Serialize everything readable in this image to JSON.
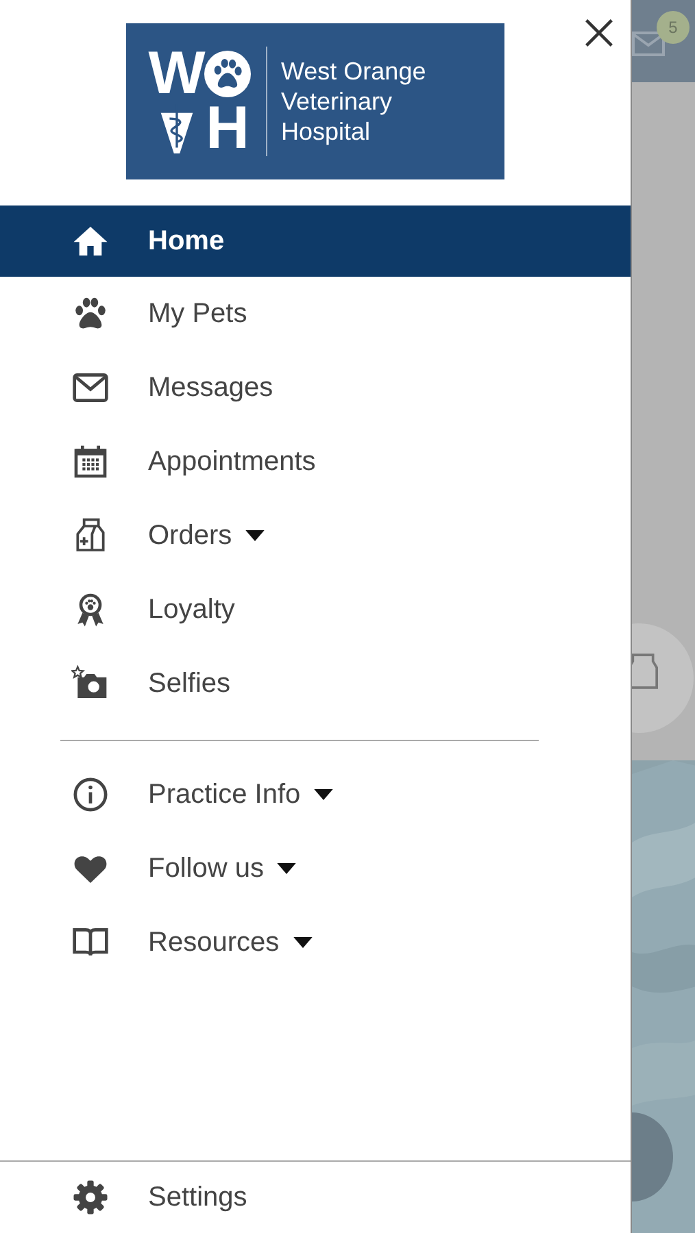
{
  "logo": {
    "letters": [
      "W",
      "H"
    ],
    "name_lines": [
      "West Orange",
      "Veterinary",
      "Hospital"
    ]
  },
  "menu_groups": [
    [
      {
        "kind": "home",
        "label": "Home",
        "selected": true,
        "expandable": false
      },
      {
        "kind": "paw",
        "label": "My Pets",
        "selected": false,
        "expandable": false
      },
      {
        "kind": "mail",
        "label": "Messages",
        "selected": false,
        "expandable": false
      },
      {
        "kind": "calendar",
        "label": "Appointments",
        "selected": false,
        "expandable": false
      },
      {
        "kind": "bag",
        "label": "Orders",
        "selected": false,
        "expandable": true
      },
      {
        "kind": "award",
        "label": "Loyalty",
        "selected": false,
        "expandable": false
      },
      {
        "kind": "camera",
        "label": "Selfies",
        "selected": false,
        "expandable": false
      }
    ],
    [
      {
        "kind": "info",
        "label": "Practice Info",
        "selected": false,
        "expandable": true
      },
      {
        "kind": "heart",
        "label": "Follow us",
        "selected": false,
        "expandable": true
      },
      {
        "kind": "book",
        "label": "Resources",
        "selected": false,
        "expandable": true
      }
    ]
  ],
  "footer_item": {
    "kind": "gear",
    "label": "Settings"
  },
  "background_page": {
    "message_badge": "5"
  }
}
